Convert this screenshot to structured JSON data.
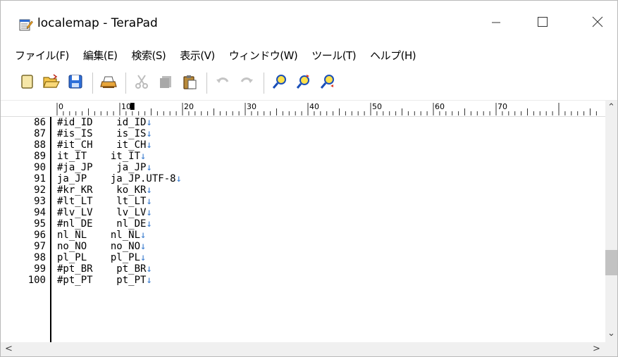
{
  "window": {
    "title": "localemap - TeraPad",
    "app_icon": "terapad-notepad-icon",
    "controls": {
      "minimize": "minimize-icon",
      "maximize": "maximize-icon",
      "close": "close-icon"
    }
  },
  "menu": [
    "ファイル(F)",
    "編集(E)",
    "検索(S)",
    "表示(V)",
    "ウィンドウ(W)",
    "ツール(T)",
    "ヘルプ(H)"
  ],
  "toolbar": {
    "groups": [
      [
        "new-file-icon",
        "open-file-icon",
        "save-icon"
      ],
      [
        "print-icon"
      ],
      [
        "cut-icon",
        "copy-icon",
        "paste-icon"
      ],
      [
        "undo-icon",
        "redo-icon"
      ],
      [
        "find-icon",
        "find-next-icon",
        "find-prev-icon"
      ]
    ]
  },
  "ruler": {
    "labels": [
      "0",
      "10",
      "20",
      "30",
      "40",
      "50",
      "60",
      "70"
    ]
  },
  "editor": {
    "eol_marker": "↓",
    "lines": [
      {
        "n": "86",
        "text": "#id_ID    id_ID"
      },
      {
        "n": "87",
        "text": "#is_IS    is_IS"
      },
      {
        "n": "88",
        "text": "#it_CH    it_CH"
      },
      {
        "n": "89",
        "text": "it_IT    it_IT"
      },
      {
        "n": "90",
        "text": "#ja_JP    ja_JP"
      },
      {
        "n": "91",
        "text": "ja_JP    ja_JP.UTF-8"
      },
      {
        "n": "92",
        "text": "#kr_KR    ko_KR"
      },
      {
        "n": "93",
        "text": "#lt_LT    lt_LT"
      },
      {
        "n": "94",
        "text": "#lv_LV    lv_LV"
      },
      {
        "n": "95",
        "text": "#nl_DE    nl_DE"
      },
      {
        "n": "96",
        "text": "nl_NL    nl_NL"
      },
      {
        "n": "97",
        "text": "no_NO    no_NO"
      },
      {
        "n": "98",
        "text": "pl_PL    pl_PL"
      },
      {
        "n": "99",
        "text": "#pt_BR    pt_BR"
      },
      {
        "n": "100",
        "text": "#pt_PT    pt_PT"
      }
    ]
  },
  "scroll": {
    "vertical_position_fraction": 0.72
  },
  "colors": {
    "eol_marker": "#3a7ccf",
    "background": "#ffffff",
    "scrollbar": "#f0f0f0",
    "scroll_thumb": "#c2c2c2"
  }
}
